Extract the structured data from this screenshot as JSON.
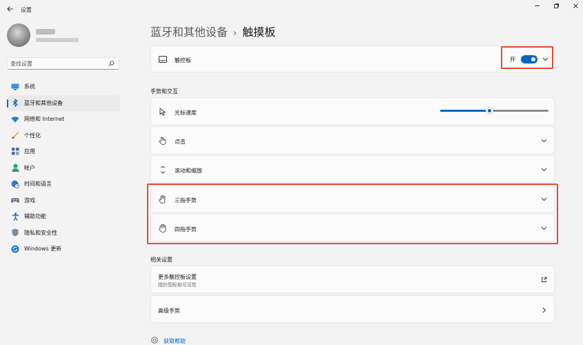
{
  "window": {
    "title": "设置"
  },
  "search": {
    "placeholder": "查找设置"
  },
  "sidebar": {
    "items": [
      {
        "label": "系统",
        "icon": "monitor-icon"
      },
      {
        "label": "蓝牙和其他设备",
        "icon": "bluetooth-icon",
        "active": true
      },
      {
        "label": "网络和 Internet",
        "icon": "wifi-icon"
      },
      {
        "label": "个性化",
        "icon": "brush-icon"
      },
      {
        "label": "应用",
        "icon": "apps-icon"
      },
      {
        "label": "帐户",
        "icon": "person-icon"
      },
      {
        "label": "时间和语言",
        "icon": "globe-clock-icon"
      },
      {
        "label": "游戏",
        "icon": "gamepad-icon"
      },
      {
        "label": "辅助功能",
        "icon": "accessibility-icon"
      },
      {
        "label": "隐私和安全性",
        "icon": "shield-icon"
      },
      {
        "label": "Windows 更新",
        "icon": "sync-icon"
      }
    ]
  },
  "breadcrumb": {
    "parent": "蓝牙和其他设备",
    "separator": "›",
    "current": "触摸板"
  },
  "touchpad": {
    "label": "触控板",
    "toggle_text": "开",
    "toggle_on": true
  },
  "gestures": {
    "section_title": "手势和交互",
    "cursor_speed_label": "光标速度",
    "cursor_speed_value": 0.45,
    "items": [
      "点击",
      "滚动和缩放",
      "三指手势",
      "四指手势"
    ]
  },
  "related": {
    "section_title": "相关设置",
    "more_settings_label": "更多触控板设置",
    "more_settings_sub": "指针图标和可见性",
    "advanced_label": "高级手势"
  },
  "help": {
    "label": "获取帮助"
  },
  "colors": {
    "accent": "#0067c0",
    "highlight": "#e34b33"
  }
}
